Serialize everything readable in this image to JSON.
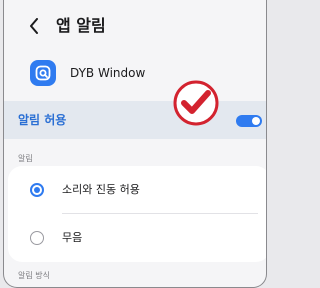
{
  "header": {
    "title": "앱 알림",
    "back_icon": "chevron-left-icon"
  },
  "app": {
    "name": "DYB Window",
    "icon": "app-logo-icon",
    "icon_color": "#2f7bf0"
  },
  "overlay": {
    "icon": "checkmark-badge-icon",
    "color": "#d3232f"
  },
  "allow_notifications": {
    "label": "알림 허용",
    "enabled": true,
    "accent": "#2a6fd4"
  },
  "notification_section": {
    "label": "알림",
    "options": [
      {
        "label": "소리와 진동 허용",
        "selected": true
      },
      {
        "label": "무음",
        "selected": false
      }
    ]
  },
  "style_section": {
    "label": "알림 방식"
  }
}
